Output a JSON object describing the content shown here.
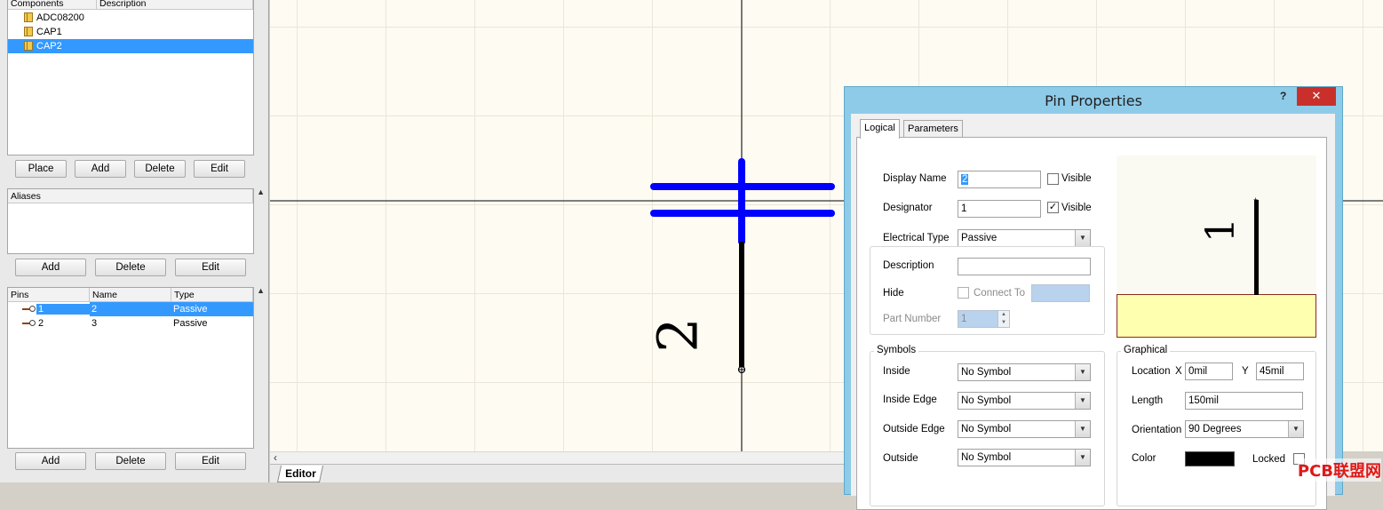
{
  "components": {
    "columns": [
      "Components",
      "Description"
    ],
    "items": [
      "ADC08200",
      "CAP1",
      "CAP2"
    ],
    "selected_index": 2,
    "buttons": [
      "Place",
      "Add",
      "Delete",
      "Edit"
    ]
  },
  "aliases": {
    "columns": [
      "Aliases"
    ],
    "buttons": [
      "Add",
      "Delete",
      "Edit"
    ]
  },
  "pins": {
    "columns": [
      "Pins",
      "Name",
      "Type"
    ],
    "rows": [
      {
        "pin": "1",
        "name": "2",
        "type": "Passive"
      },
      {
        "pin": "2",
        "name": "3",
        "type": "Passive"
      }
    ],
    "selected_index": 0,
    "buttons": [
      "Add",
      "Delete",
      "Edit"
    ]
  },
  "canvas": {
    "pin_label": "2",
    "editor_tab": "Editor"
  },
  "dialog": {
    "title": "Pin Properties",
    "help": "?",
    "close": "✕",
    "tabs": [
      "Logical",
      "Parameters"
    ],
    "active_tab": "Logical",
    "display_name_label": "Display Name",
    "display_name": "2",
    "display_name_visible_label": "Visible",
    "display_name_visible": false,
    "designator_label": "Designator",
    "designator": "1",
    "designator_visible_label": "Visible",
    "designator_visible": true,
    "electrical_type_label": "Electrical Type",
    "electrical_type": "Passive",
    "description_label": "Description",
    "description": "",
    "hide_label": "Hide",
    "connect_to_label": "Connect To",
    "part_number_label": "Part Number",
    "part_number": "1",
    "preview_label": "1",
    "symbols": {
      "title": "Symbols",
      "inside_label": "Inside",
      "inside": "No Symbol",
      "inside_edge_label": "Inside Edge",
      "inside_edge": "No Symbol",
      "outside_edge_label": "Outside Edge",
      "outside_edge": "No Symbol",
      "outside_label": "Outside",
      "outside": "No Symbol"
    },
    "graphical": {
      "title": "Graphical",
      "location_label": "Location",
      "x_label": "X",
      "x": "0mil",
      "y_label": "Y",
      "y": "45mil",
      "length_label": "Length",
      "length": "150mil",
      "orientation_label": "Orientation",
      "orientation": "90 Degrees",
      "color_label": "Color",
      "color": "#000000",
      "locked_label": "Locked"
    }
  },
  "watermark": "PCB联盟网",
  "colors": {
    "selection": "#3399ff",
    "pin_blue": "#0000ff",
    "dialog_frame": "#8ecbe8",
    "close_red": "#c9302c"
  }
}
